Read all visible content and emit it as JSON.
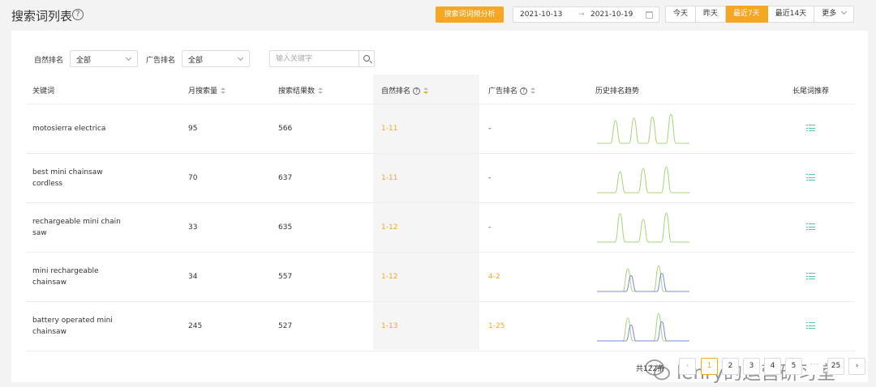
{
  "header": {
    "title": "搜索词列表",
    "help_glyph": "?",
    "analyze_label": "搜索词词频分析",
    "date_start": "2021-10-13",
    "date_arrow": "→",
    "date_end": "2021-10-19",
    "range_tabs": [
      {
        "label": "今天",
        "active": false
      },
      {
        "label": "昨天",
        "active": false
      },
      {
        "label": "最近7天",
        "active": true
      },
      {
        "label": "最近14天",
        "active": false
      },
      {
        "label": "更多",
        "active": false
      }
    ]
  },
  "filters": {
    "natural_label": "自然排名",
    "natural_value": "全部",
    "ad_label": "广告排名",
    "ad_value": "全部",
    "search_placeholder": "输入关键字"
  },
  "table": {
    "columns": {
      "keyword": "关键词",
      "monthly": "月搜索量",
      "results": "搜索结果数",
      "natural_rank": "自然排名",
      "ad_rank": "广告排名",
      "trend": "历史排名趋势",
      "longtail": "长尾词推荐"
    },
    "rows": [
      {
        "keyword": "motosierra electrica",
        "monthly": "95",
        "results": "566",
        "natural_rank": "1-11",
        "ad_rank": "-",
        "trend_colors": [
          "#a8d37e"
        ],
        "peaks": [
          0.3,
          0.22,
          0.18,
          0.1
        ]
      },
      {
        "keyword": "best mini chainsaw cordless",
        "monthly": "70",
        "results": "637",
        "natural_rank": "1-11",
        "ad_rank": "-",
        "trend_colors": [
          "#a8d37e"
        ],
        "peaks": [
          0.35,
          0.25,
          0.2
        ]
      },
      {
        "keyword": "rechargeable mini chain saw",
        "monthly": "33",
        "results": "635",
        "natural_rank": "1-12",
        "ad_rank": "-",
        "trend_colors": [
          "#a8d37e"
        ],
        "peaks": [
          0.12,
          0.3,
          0.1
        ]
      },
      {
        "keyword": "mini rechargeable chainsaw",
        "monthly": "34",
        "results": "557",
        "natural_rank": "1-12",
        "ad_rank": "4-2",
        "trend_colors": [
          "#a8d37e",
          "#7b8bd4"
        ],
        "peaks": [
          0.3,
          0.2
        ]
      },
      {
        "keyword": "battery operated mini chainsaw",
        "monthly": "245",
        "results": "527",
        "natural_rank": "1-13",
        "ad_rank": "1-25",
        "trend_colors": [
          "#a8d37e",
          "#7b8bd4"
        ],
        "peaks": [
          0.3,
          0.15
        ]
      }
    ]
  },
  "pagination": {
    "total": "共122条",
    "prev": "‹",
    "next": "›",
    "pages": [
      "1",
      "2",
      "3",
      "4",
      "5"
    ],
    "ellipsis": "···",
    "last": "25",
    "current": "1"
  },
  "watermark": {
    "text": "lenry的运营研习室"
  },
  "colors": {
    "accent": "#f5a623",
    "link_icon": "#5bc4b8"
  }
}
